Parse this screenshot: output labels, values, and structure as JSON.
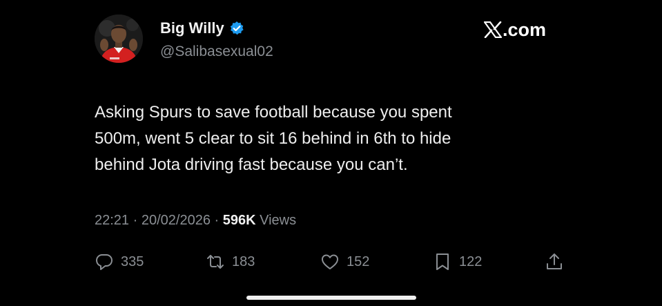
{
  "author": {
    "display_name": "Big Willy",
    "handle": "@Salibasexual02",
    "verified": true,
    "avatar_icon": "profile-photo"
  },
  "brand": {
    "logo_text": ".com",
    "logo_icon": "x-logo-icon"
  },
  "tweet": {
    "lines": [
      "Asking Spurs to save football because you spent",
      "500m, went 5 clear to sit 16 behind in 6th to hide",
      "behind Jota driving fast because you can’t."
    ]
  },
  "meta": {
    "time": "22:21",
    "separator": "·",
    "date": "20/02/2026",
    "views_count": "596K",
    "views_label": "Views"
  },
  "actions": {
    "replies": "335",
    "reposts": "183",
    "likes": "152",
    "bookmarks": "122"
  },
  "colors": {
    "background": "#000000",
    "text_primary": "#e7e9ea",
    "text_secondary": "#8b8f94",
    "verified_blue": "#1d9bf0"
  }
}
